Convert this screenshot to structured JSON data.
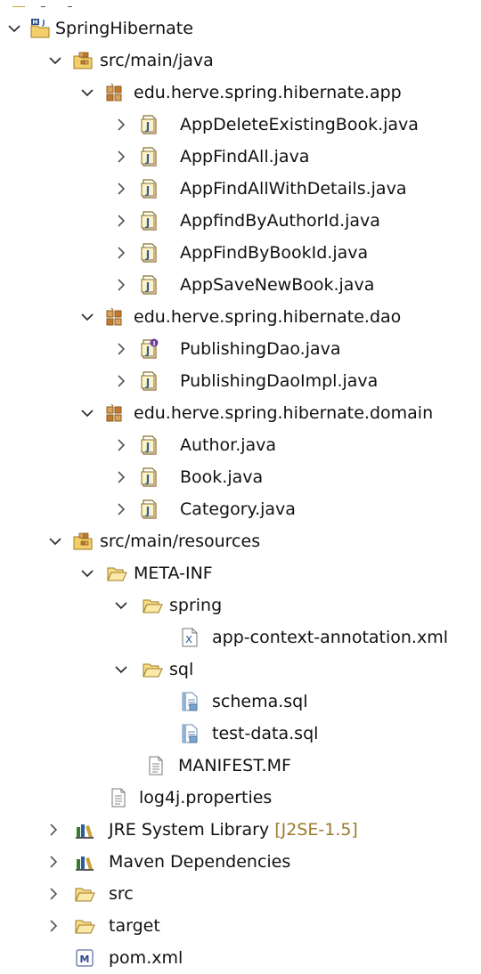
{
  "tree": {
    "project": {
      "label": "SpringHibernate",
      "icon": "maven-project-icon"
    },
    "src_main_java": {
      "label": "src/main/java",
      "icon": "source-folder-icon"
    },
    "pkg_app": {
      "label": "edu.herve.spring.hibernate.app",
      "icon": "package-icon",
      "files": [
        "AppDeleteExistingBook.java",
        "AppFindAll.java",
        "AppFindAllWithDetails.java",
        "AppfindByAuthorId.java",
        "AppFindByBookId.java",
        "AppSaveNewBook.java"
      ]
    },
    "pkg_dao": {
      "label": "edu.herve.spring.hibernate.dao",
      "icon": "package-icon",
      "files": [
        "PublishingDao.java",
        "PublishingDaoImpl.java"
      ]
    },
    "pkg_domain": {
      "label": "edu.herve.spring.hibernate.domain",
      "icon": "package-icon",
      "files": [
        "Author.java",
        "Book.java",
        "Category.java"
      ]
    },
    "src_main_resources": {
      "label": "src/main/resources",
      "icon": "source-folder-icon"
    },
    "meta_inf": {
      "label": "META-INF",
      "icon": "folder-open-icon"
    },
    "spring": {
      "label": "spring",
      "icon": "folder-open-icon"
    },
    "app_context": {
      "label": "app-context-annotation.xml",
      "icon": "xml-file-icon"
    },
    "sql": {
      "label": "sql",
      "icon": "folder-open-icon"
    },
    "schema": {
      "label": "schema.sql",
      "icon": "sql-file-icon"
    },
    "test_data": {
      "label": "test-data.sql",
      "icon": "sql-file-icon"
    },
    "manifest": {
      "label": "MANIFEST.MF",
      "icon": "text-file-icon"
    },
    "log4j": {
      "label": "log4j.properties",
      "icon": "text-file-icon"
    },
    "jre": {
      "label": "JRE System Library",
      "decoration": "[J2SE-1.5]",
      "icon": "library-icon"
    },
    "maven_deps": {
      "label": "Maven Dependencies",
      "icon": "library-icon"
    },
    "src": {
      "label": "src",
      "icon": "folder-icon"
    },
    "target": {
      "label": "target",
      "icon": "folder-icon"
    },
    "pom": {
      "label": "pom.xml",
      "icon": "maven-pom-icon"
    }
  },
  "colors": {
    "java_icon": "#2f5ea8",
    "interface_icon": "#6b3fa0",
    "folder": "#e8b94a",
    "package": "#b5651d",
    "decoration": "#9c7a2c"
  }
}
